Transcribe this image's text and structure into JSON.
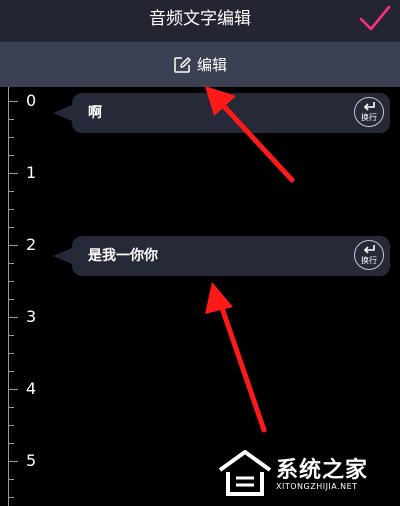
{
  "header": {
    "title": "音频文字编辑",
    "confirm_icon": "checkmark-icon",
    "confirm_color": "#ff2f80"
  },
  "edit_bar": {
    "label": "编辑",
    "icon": "edit-icon"
  },
  "ruler": {
    "labels": [
      "0",
      "1",
      "2",
      "3",
      "4",
      "5"
    ]
  },
  "segments": [
    {
      "text": "啊",
      "newline_label": "换行",
      "newline_icon": "return-arrow-icon"
    },
    {
      "text": "是我一你你",
      "newline_label": "换行",
      "newline_icon": "return-arrow-icon"
    }
  ],
  "annotation": {
    "arrow_color": "#ff1a1a"
  },
  "watermark": {
    "brand": "系统之家",
    "url": "XITONGZHIJIA.NET"
  }
}
